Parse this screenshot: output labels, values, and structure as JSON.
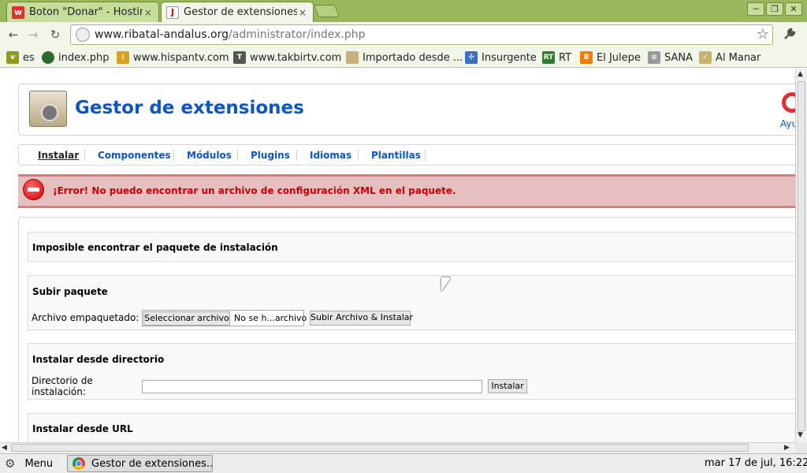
{
  "tabs": [
    {
      "title": "Boton \"Donar\" - Hosting",
      "close": "×"
    },
    {
      "title": "Gestor de extensiones :",
      "close": "×"
    }
  ],
  "window_buttons": {
    "minimize": "─",
    "maximize": "❐",
    "close": "✕"
  },
  "address": {
    "host": "www.ribatal-andalus.org",
    "path": "/administrator/index.php"
  },
  "bookmarks": [
    {
      "label": "es",
      "color": "#8e9b1d",
      "glyph": "v"
    },
    {
      "label": "index.php",
      "color": "#2e6b2e",
      "glyph": ""
    },
    {
      "label": "www.hispantv.com",
      "color": "#d9a21e",
      "glyph": "⁞"
    },
    {
      "label": "www.takbirtv.com",
      "color": "#555555",
      "glyph": "T"
    },
    {
      "label": "Importado desde ...",
      "color": "#c9b27a",
      "glyph": ""
    },
    {
      "label": "Insurgente",
      "color": "#3a6fc4",
      "glyph": "✣"
    },
    {
      "label": "RT",
      "color": "#2d7d2d",
      "glyph": "RT"
    },
    {
      "label": "El Julepe",
      "color": "#f57d00",
      "glyph": "B"
    },
    {
      "label": "SANA",
      "color": "#9a9a9a",
      "glyph": "≡"
    },
    {
      "label": "Al Manar",
      "color": "#c8b26c",
      "glyph": "✓"
    }
  ],
  "page": {
    "title": "Gestor de extensiones",
    "help_label": "Ayu",
    "subnav": [
      "Instalar",
      "Componentes",
      "Módulos",
      "Plugins",
      "Idiomas",
      "Plantillas"
    ],
    "error": "¡Error! No puedo encontrar un archivo de configuración XML en el paquete.",
    "panel1_title": "Imposible encontrar el paquete de instalación",
    "upload": {
      "title": "Subir paquete",
      "label": "Archivo empaquetado:",
      "choose_button": "Seleccionar archivo",
      "file_status": "No se h...archivo",
      "submit_button": "Subir Archivo & Instalar"
    },
    "directory": {
      "title": "Instalar desde directorio",
      "label_line1": "Directorio de",
      "label_line2": "instalación:",
      "value": "",
      "button": "Instalar"
    },
    "url": {
      "title": "Instalar desde URL"
    }
  },
  "taskbar": {
    "menu_label": "Menu",
    "window_label": "Gestor de extensiones...",
    "clock": "mar 17 de jul, 16:22"
  },
  "colors": {
    "link": "#0b55c4",
    "error_text": "#cc0000",
    "error_bg": "#e6c0c0",
    "chrome_frame": "#9ab85b"
  }
}
